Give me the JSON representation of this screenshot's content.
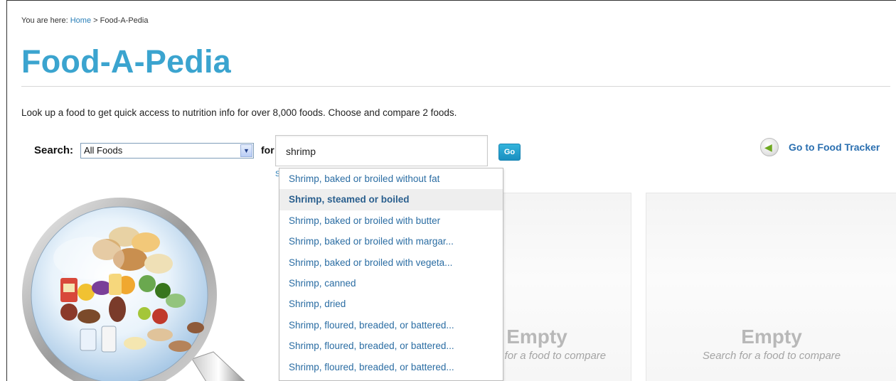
{
  "breadcrumb": {
    "prefix": "You are here:",
    "home": "Home",
    "separator": " > ",
    "current": "Food-A-Pedia"
  },
  "page_title": "Food-A-Pedia",
  "intro": "Look up a food to get quick access to nutrition info for over 8,000 foods. Choose and compare 2 foods.",
  "search": {
    "label": "Search:",
    "category_selected": "All Foods",
    "for_label": "for",
    "query": "shrimp",
    "go_label": "Go"
  },
  "tracker_link": {
    "label": "Go to Food Tracker",
    "icon": "arrow-left-icon"
  },
  "stray_text": "S",
  "suggestions": [
    "Shrimp, baked or broiled without fat",
    "Shrimp, steamed or boiled",
    "Shrimp, baked or broiled with butter",
    "Shrimp, baked or broiled with margar...",
    "Shrimp, baked or broiled with vegeta...",
    "Shrimp, canned",
    "Shrimp, dried",
    "Shrimp, floured, breaded, or battered...",
    "Shrimp, floured, breaded, or battered...",
    "Shrimp, floured, breaded, or battered..."
  ],
  "highlighted_suggestion": 1,
  "compare_cards": [
    {
      "title": "Empty",
      "subtitle": "Search for a food to compare"
    },
    {
      "title": "Empty",
      "subtitle": "Search for a food to compare"
    }
  ],
  "colors": {
    "title": "#3ba4cf",
    "link": "#2a7fb8",
    "go_button": "#1a8fc0",
    "tracker_arrow": "#6ea820"
  }
}
